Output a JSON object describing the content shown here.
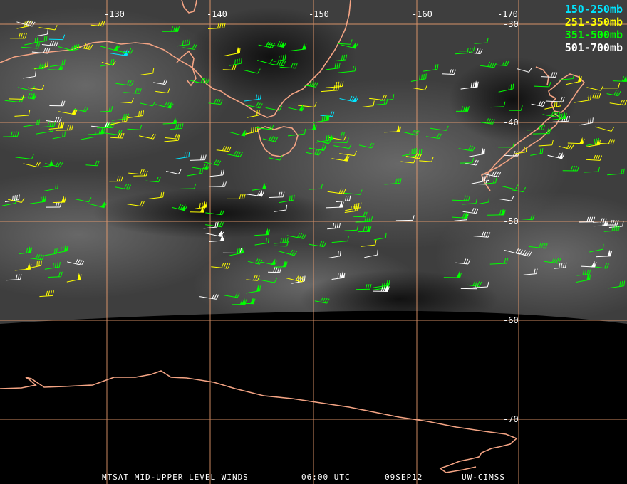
{
  "map": {
    "longitude_labels": [
      "-130",
      "-140",
      "-150",
      "-160",
      "-170"
    ],
    "latitude_labels": [
      "-30",
      "-40",
      "-50",
      "-60",
      "-70"
    ],
    "colors": {
      "background": "#000000",
      "imagery_dark": "#1e1e1e",
      "imagery_light": "#6a6a6a",
      "grid": "#f0a070",
      "coastline": "#f4a484",
      "text": "#ffffff"
    }
  },
  "legend": {
    "items": [
      {
        "label": "150-250mb",
        "color": "#00e5ff"
      },
      {
        "label": "251-350mb",
        "color": "#ffff00"
      },
      {
        "label": "351-500mb",
        "color": "#00ff00"
      },
      {
        "label": "501-700mb",
        "color": "#ffffff"
      }
    ]
  },
  "footer": {
    "product": "MTSAT MID-UPPER LEVEL WINDS",
    "time": "06:00 UTC",
    "date": "09SEP12",
    "source": "UW-CIMSS"
  }
}
